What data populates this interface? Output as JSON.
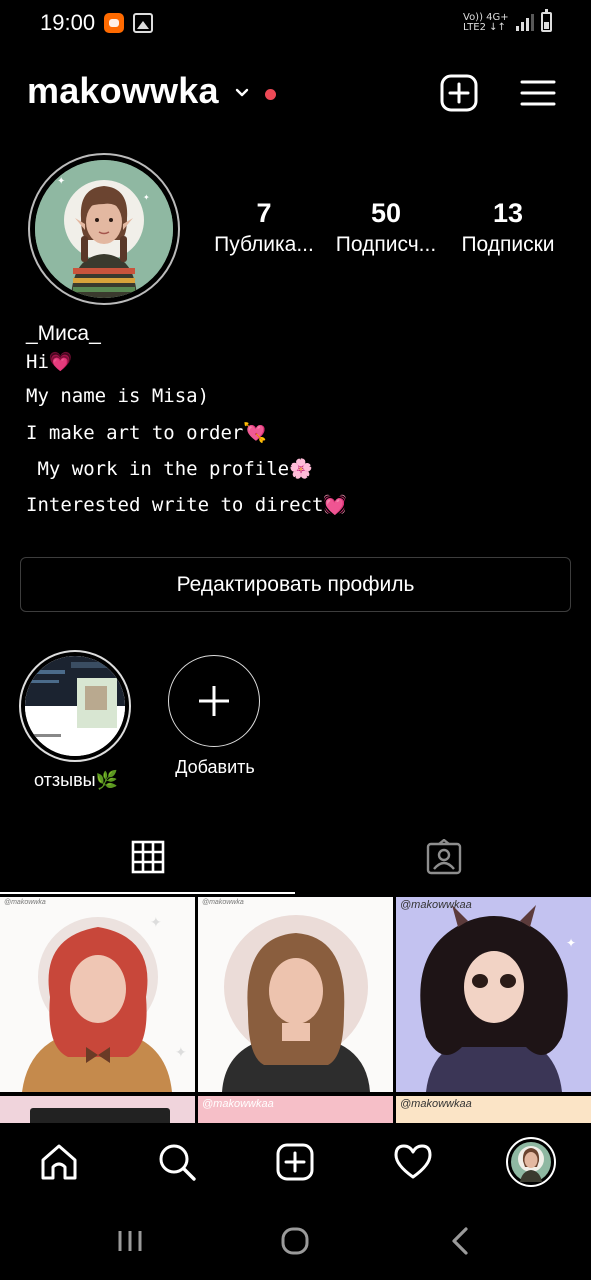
{
  "status_bar": {
    "time": "19:00",
    "network_top": "Vo)) 4G+",
    "network_bottom": "LTE2 ↓↑",
    "icons": [
      "mi-app-icon",
      "gallery-icon",
      "signal-icon",
      "battery-icon"
    ]
  },
  "header": {
    "username": "makowwka",
    "accent_notification_color": "#ed4956",
    "icons": [
      "chevron-down-icon",
      "new-post-icon",
      "menu-icon"
    ]
  },
  "profile": {
    "stats": [
      {
        "number": "7",
        "label": "Публика..."
      },
      {
        "number": "50",
        "label": "Подписч..."
      },
      {
        "number": "13",
        "label": "Подписки"
      }
    ],
    "full_name": "_Миса_",
    "bio_lines": [
      "Hi💗",
      "My name is Misa)",
      "I make art to order💘",
      " My work in the profile🌸",
      "Interested write to direct💓"
    ],
    "edit_button": "Редактировать профиль"
  },
  "highlights": [
    {
      "label": "отзывы🌿"
    },
    {
      "label": "Добавить"
    }
  ],
  "tabs": [
    "grid-icon",
    "tagged-icon"
  ],
  "grid_posts": [
    {
      "watermark": "@makowwka"
    },
    {
      "watermark": "@makowwka"
    },
    {
      "watermark": "@makowwkaa"
    },
    {
      "watermark": ""
    },
    {
      "watermark": "@makowwkaa"
    },
    {
      "watermark": "@makowwkaa"
    }
  ],
  "bottom_nav": [
    "home-icon",
    "search-icon",
    "new-post-icon",
    "activity-heart-icon",
    "profile-avatar"
  ],
  "system_nav": [
    "recents-icon",
    "home-circle-icon",
    "back-icon"
  ]
}
